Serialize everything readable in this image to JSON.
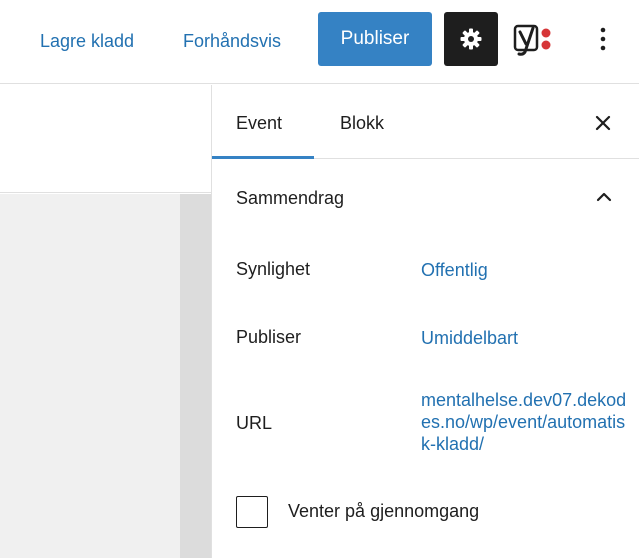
{
  "header": {
    "save_draft_label": "Lagre kladd",
    "preview_label": "Forhåndsvis",
    "publish_label": "Publiser",
    "settings_icon": "gear-icon",
    "yoast_icon": "yoast-logo-icon",
    "more_icon": "vertical-ellipsis-icon"
  },
  "sidebar": {
    "tabs": [
      {
        "label": "Event",
        "active": true
      },
      {
        "label": "Blokk",
        "active": false
      }
    ],
    "close_icon": "close-icon",
    "panel": {
      "title": "Sammendrag",
      "expanded": true,
      "chevron_icon": "chevron-up-icon",
      "rows": [
        {
          "label": "Synlighet",
          "value": "Offentlig"
        },
        {
          "label": "Publiser",
          "value": "Umiddelbart"
        },
        {
          "label": "URL",
          "value": "mentalhelse.dev07.dekodes.no/wp/event/automatisk-kladd/"
        }
      ],
      "checkbox": {
        "label": "Venter på gjennomgang",
        "checked": false
      }
    }
  },
  "colors": {
    "accent": "#3582c4",
    "link": "#2271b1",
    "dark_button": "#1e1e1e",
    "yoast_red": "#d63638"
  }
}
